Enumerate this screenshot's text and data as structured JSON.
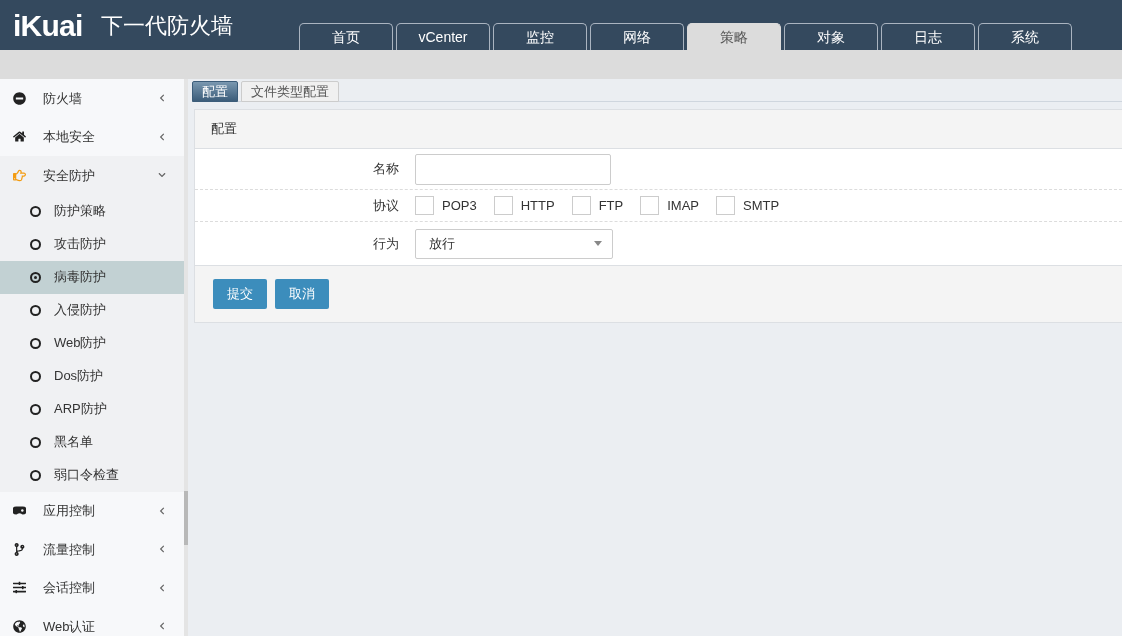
{
  "header": {
    "logo": "iKuai",
    "title": "下一代防火墙"
  },
  "nav_tabs": [
    {
      "label": "首页",
      "selected": false
    },
    {
      "label": "vCenter",
      "selected": false
    },
    {
      "label": "监控",
      "selected": false
    },
    {
      "label": "网络",
      "selected": false
    },
    {
      "label": "策略",
      "selected": true
    },
    {
      "label": "对象",
      "selected": false
    },
    {
      "label": "日志",
      "selected": false
    },
    {
      "label": "系统",
      "selected": false
    }
  ],
  "sidebar": {
    "items": [
      {
        "label": "防火墙",
        "expanded": false
      },
      {
        "label": "本地安全",
        "expanded": false
      },
      {
        "label": "安全防护",
        "expanded": true,
        "children": [
          {
            "label": "防护策略",
            "selected": false
          },
          {
            "label": "攻击防护",
            "selected": false
          },
          {
            "label": "病毒防护",
            "selected": true
          },
          {
            "label": "入侵防护",
            "selected": false
          },
          {
            "label": "Web防护",
            "selected": false
          },
          {
            "label": "Dos防护",
            "selected": false
          },
          {
            "label": "ARP防护",
            "selected": false
          },
          {
            "label": "黑名单",
            "selected": false
          },
          {
            "label": "弱口令检查",
            "selected": false
          }
        ]
      },
      {
        "label": "应用控制",
        "expanded": false
      },
      {
        "label": "流量控制",
        "expanded": false
      },
      {
        "label": "会话控制",
        "expanded": false
      },
      {
        "label": "Web认证",
        "expanded": false
      }
    ]
  },
  "sub_tabs": [
    {
      "label": "配置",
      "selected": true
    },
    {
      "label": "文件类型配置",
      "selected": false
    }
  ],
  "panel": {
    "title": "配置",
    "name_field": {
      "label": "名称"
    },
    "protocol": {
      "label": "协议",
      "options": [
        {
          "label": "POP3",
          "checked": false
        },
        {
          "label": "HTTP",
          "checked": false
        },
        {
          "label": "FTP",
          "checked": false
        },
        {
          "label": "IMAP",
          "checked": false
        },
        {
          "label": "SMTP",
          "checked": false
        }
      ]
    },
    "action": {
      "label": "行为",
      "value": "放行"
    },
    "buttons": [
      "提交",
      "取消"
    ]
  }
}
